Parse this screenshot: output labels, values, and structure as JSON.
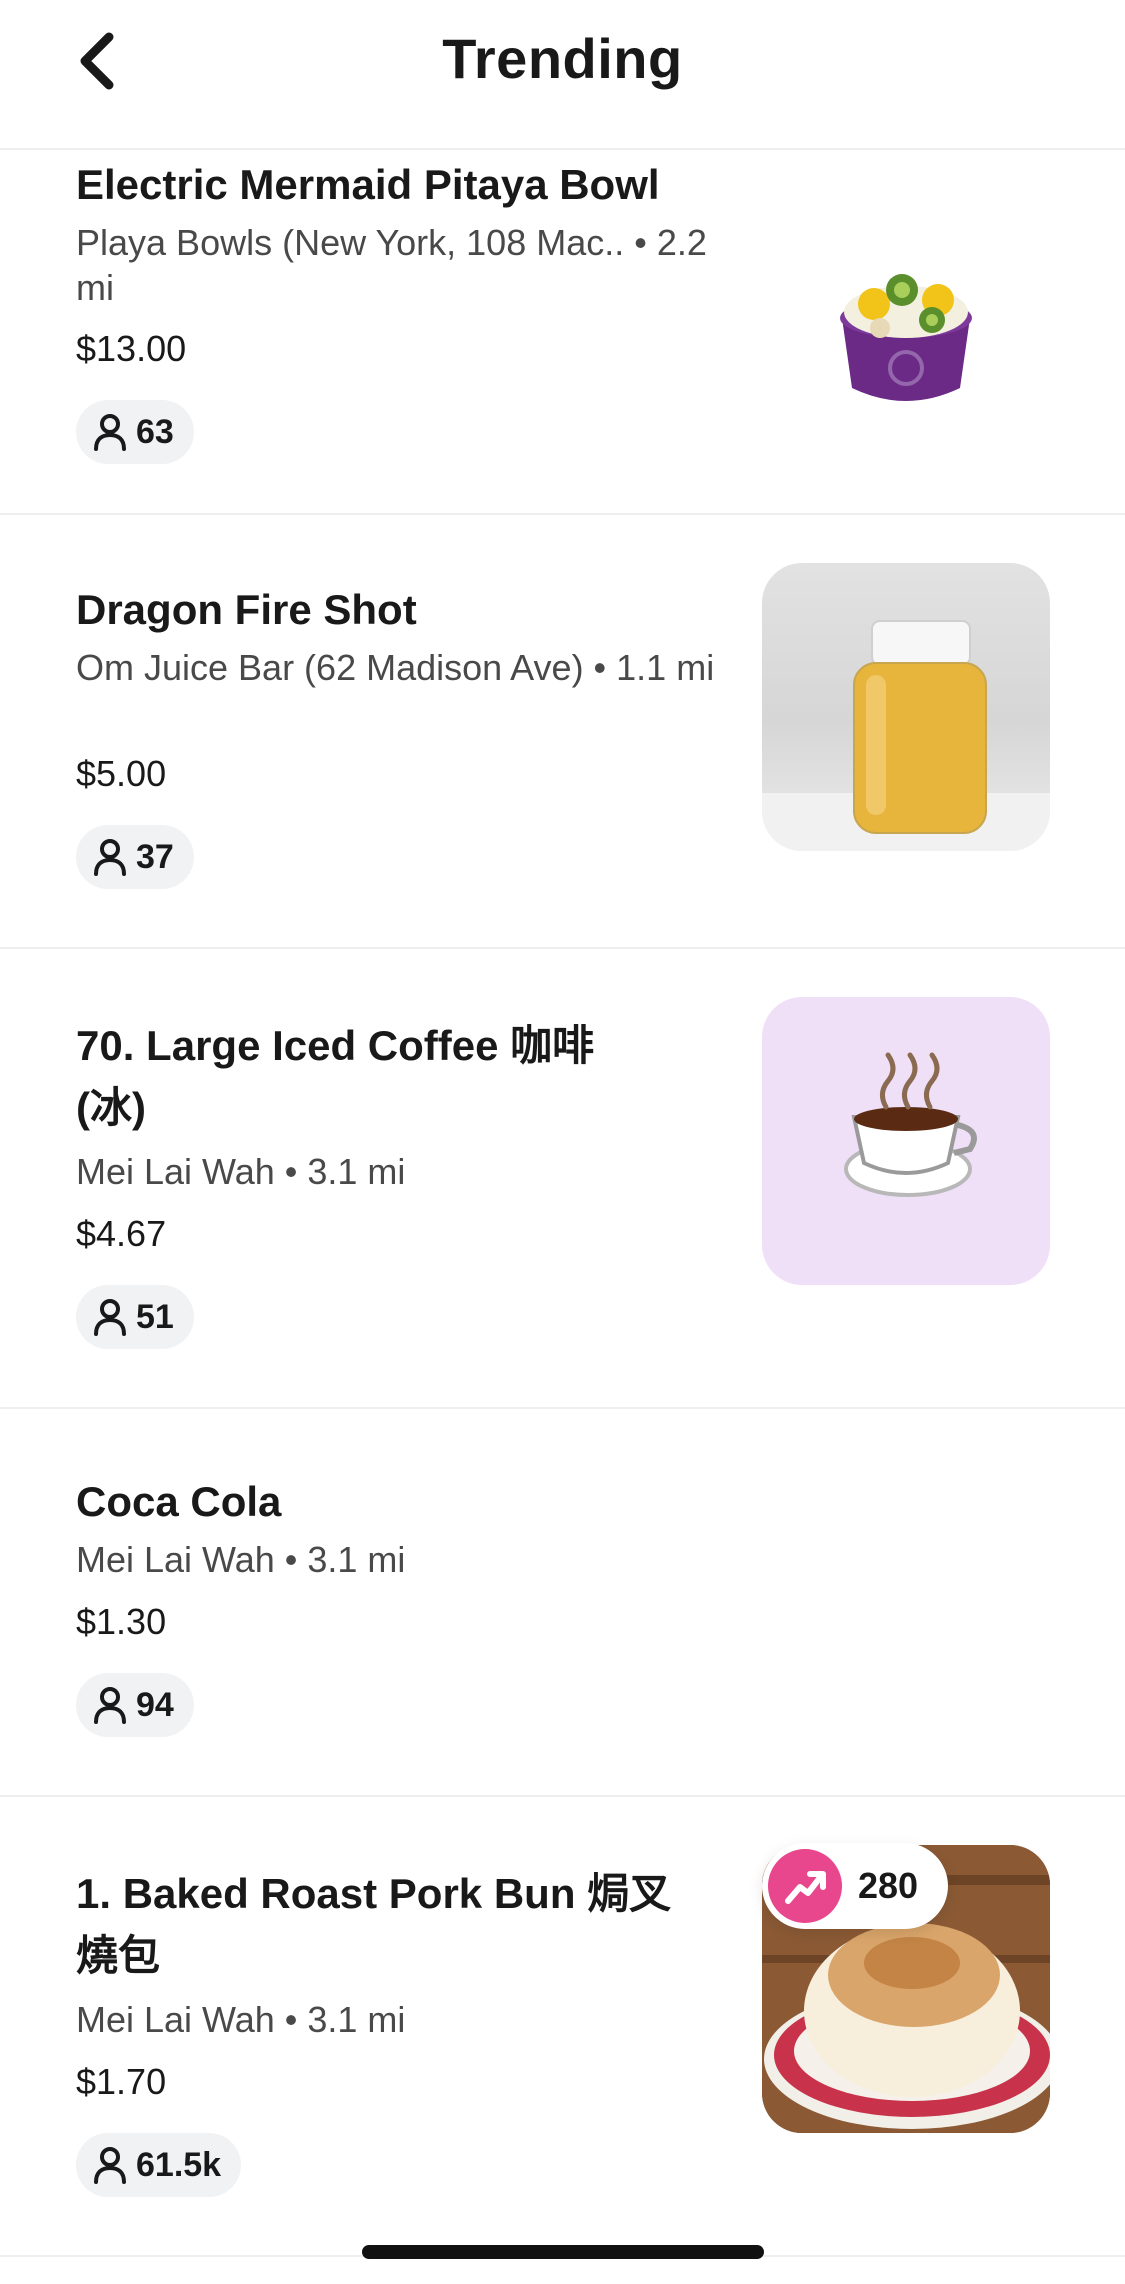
{
  "header": {
    "title": "Trending",
    "back_icon": "chevron-left-icon"
  },
  "items": [
    {
      "name": "Electric Mermaid Pitaya Bowl",
      "store": "Playa Bowls (New York, 108 Mac.. • 2.2 mi",
      "price": "$13.00",
      "count": "63"
    },
    {
      "name": "Dragon Fire Shot",
      "store": "Om Juice Bar (62 Madison Ave) • 1.1 mi",
      "price": "$5.00",
      "count": "37"
    },
    {
      "name": "70. Large Iced Coffee 咖啡(冰)",
      "store": "Mei Lai Wah • 3.1 mi",
      "price": "$4.67",
      "count": "51"
    },
    {
      "name": "Coca Cola",
      "store": "Mei Lai Wah • 3.1 mi",
      "price": "$1.30",
      "count": "94"
    },
    {
      "name": "1. Baked Roast Pork Bun 焗叉燒包",
      "store": "Mei Lai Wah • 3.1 mi",
      "price": "$1.70",
      "count": "61.5k",
      "trending_count": "280"
    }
  ],
  "icons": {
    "person": "person-icon",
    "trending": "trending-up-icon",
    "coffee": "hot-coffee-emoji"
  },
  "colors": {
    "accent": "#e8468d",
    "badge_bg": "#f1f2f4",
    "coffee_tile_bg": "#efe0f8",
    "divider": "#eeeeee"
  }
}
